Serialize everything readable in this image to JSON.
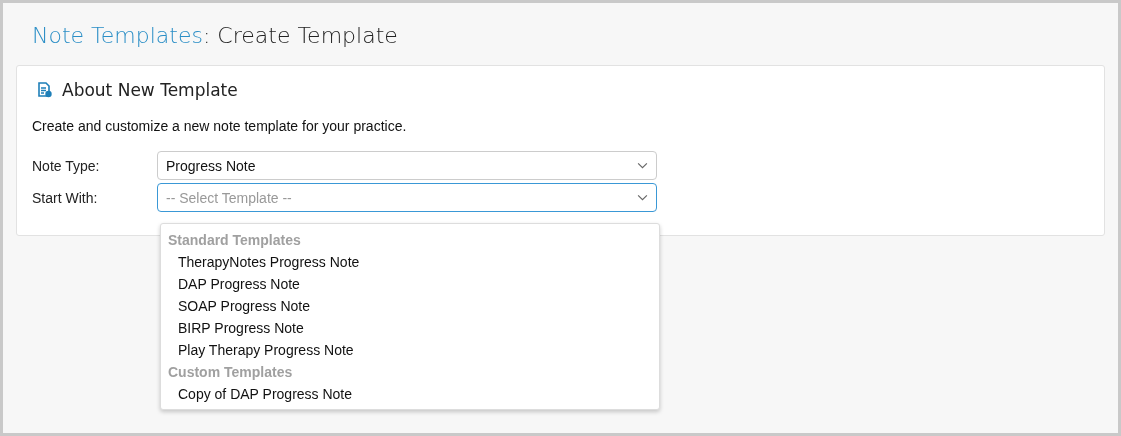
{
  "page_title": {
    "link": "Note Templates",
    "text": ": Create Template"
  },
  "card": {
    "title": "About New Template",
    "description": "Create and customize a new note template for your practice.",
    "fields": [
      {
        "label": "Note Type:",
        "value": "Progress Note",
        "focused": false
      },
      {
        "label": "Start With:",
        "placeholder": "-- Select Template --",
        "focused": true
      }
    ]
  },
  "dropdown": {
    "groups": [
      {
        "label": "Standard Templates",
        "options": [
          "TherapyNotes Progress Note",
          "DAP Progress Note",
          "SOAP Progress Note",
          "BIRP Progress Note",
          "Play Therapy Progress Note"
        ]
      },
      {
        "label": "Custom Templates",
        "options": [
          "Copy of DAP Progress Note"
        ]
      }
    ]
  }
}
